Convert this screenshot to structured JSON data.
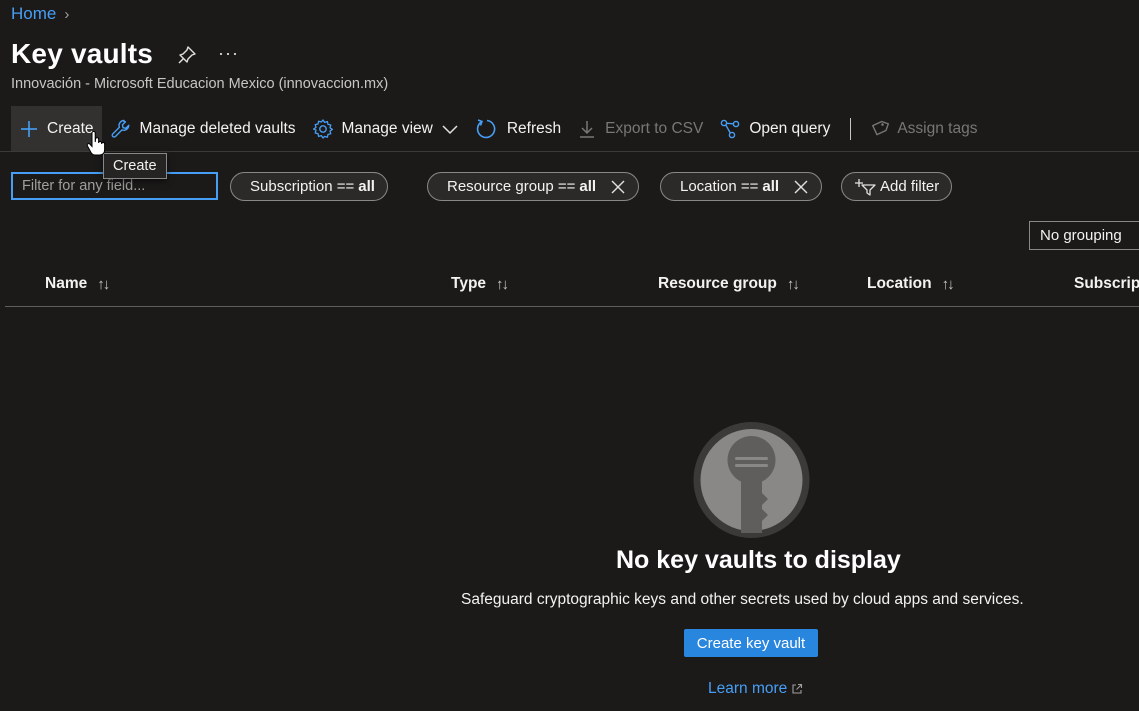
{
  "breadcrumb": {
    "home": "Home",
    "separator": "›"
  },
  "header": {
    "title": "Key vaults",
    "more": "···",
    "subtitle": "Innovación - Microsoft Educacion Mexico (innovaccion.mx)"
  },
  "toolbar": {
    "create": "Create",
    "manage_deleted": "Manage deleted vaults",
    "manage_view": "Manage view",
    "refresh": "Refresh",
    "export_csv": "Export to CSV",
    "open_query": "Open query",
    "assign_tags": "Assign tags"
  },
  "tooltip": {
    "text": "Create"
  },
  "filters": {
    "search_placeholder": "Filter for any field...",
    "subscription": {
      "label": "Subscription == ",
      "value": "all"
    },
    "resource_group": {
      "label": "Resource group == ",
      "value": "all"
    },
    "location": {
      "label": "Location == ",
      "value": "all"
    },
    "add_filter": "Add filter",
    "grouping": "No grouping"
  },
  "table": {
    "columns": [
      "Name",
      "Type",
      "Resource group",
      "Location",
      "Subscript"
    ],
    "sort_glyph": "↑↓"
  },
  "empty_state": {
    "title": "No key vaults to display",
    "description": "Safeguard cryptographic keys and other secrets used by cloud apps and services.",
    "button": "Create key vault",
    "learn_more": "Learn more"
  },
  "colors": {
    "background": "#1b1a19",
    "accent": "#479ef5",
    "primary_button": "#2886de",
    "focus_border": "#479ef5"
  }
}
